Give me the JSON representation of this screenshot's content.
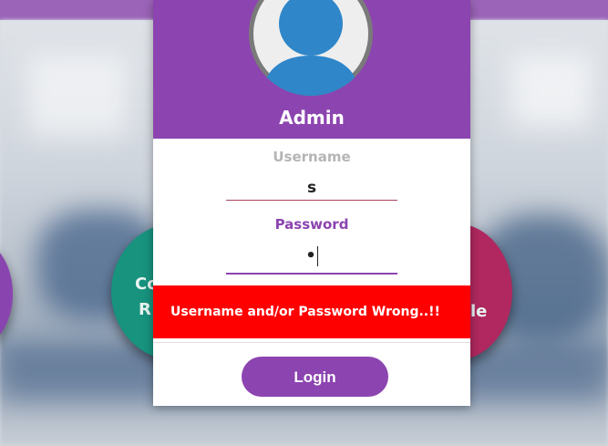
{
  "colors": {
    "accent": "#8c44b0",
    "error": "#ff0000",
    "teal": "#17937e",
    "crimson": "#b0285f",
    "avatar_blue": "#2f86c9"
  },
  "background": {
    "teal_circle_line1": "Co",
    "teal_circle_line2": "R",
    "red_circle_text": "le"
  },
  "login": {
    "role_title": "Admin",
    "avatar_icon": "user-avatar-icon",
    "username_label": "Username",
    "username_value": "s",
    "password_label": "Password",
    "password_mask": "•",
    "error_message": "Username and/or Password Wrong..!!",
    "login_button": "Login"
  }
}
